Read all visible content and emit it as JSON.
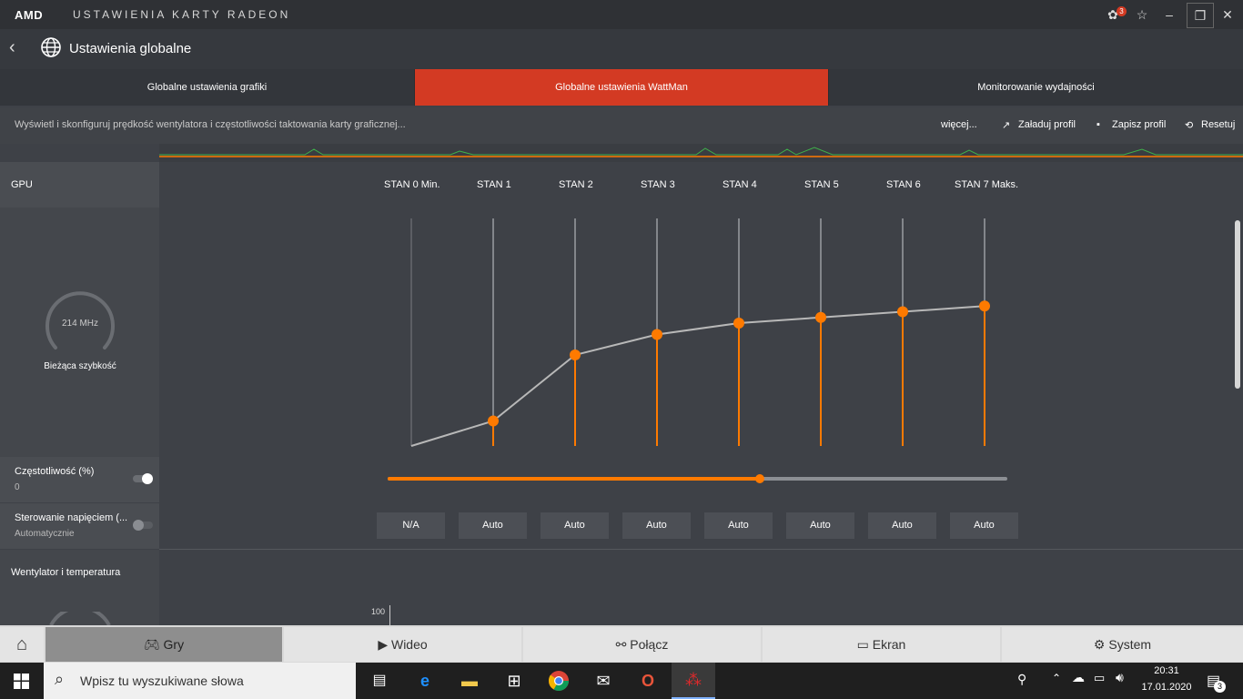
{
  "window": {
    "brand": "AMD",
    "title": "USTAWIENIA KARTY RADEON",
    "notif_badge": "3"
  },
  "header": {
    "title": "Ustawienia globalne"
  },
  "tabs": [
    {
      "label": "Globalne ustawienia grafiki",
      "active": false
    },
    {
      "label": "Globalne ustawienia WattMan",
      "active": true
    },
    {
      "label": "Monitorowanie wydajności",
      "active": false
    }
  ],
  "infobar": {
    "description": "Wyświetl i skonfiguruj prędkość wentylatora i częstotliwości taktowania karty graficznej...",
    "more": "więcej...",
    "load_profile": "Załaduj profil",
    "save_profile": "Zapisz profil",
    "reset": "Resetuj"
  },
  "gpu": {
    "section_label": "GPU",
    "gauge_value": "214 MHz",
    "gauge_label": "Bieżąca szybkość",
    "frequency": {
      "title": "Częstotliwość (%)",
      "value": "0",
      "toggle_on": true
    },
    "voltage": {
      "title": "Sterowanie napięciem (...",
      "value": "Automatycznie",
      "toggle_on": false
    },
    "states": [
      "STAN 0 Min.",
      "STAN 1",
      "STAN 2",
      "STAN 3",
      "STAN 4",
      "STAN 5",
      "STAN 6",
      "STAN 7 Maks."
    ],
    "state_values": [
      "N/A",
      "Auto",
      "Auto",
      "Auto",
      "Auto",
      "Auto",
      "Auto",
      "Auto"
    ],
    "slider_level_pct": 60
  },
  "chart_data": {
    "type": "line",
    "categories": [
      "STAN 0 Min.",
      "STAN 1",
      "STAN 2",
      "STAN 3",
      "STAN 4",
      "STAN 5",
      "STAN 6",
      "STAN 7 Maks."
    ],
    "series": [
      {
        "values": [
          0,
          11,
          40,
          49,
          54,
          56.5,
          59,
          61.5
        ]
      }
    ],
    "ylim": [
      0,
      100
    ],
    "colors": {
      "line": "#b8b8b8",
      "point": "#ff7a00"
    }
  },
  "fan": {
    "section_label": "Wentylator i temperatura",
    "y_tick": "100"
  },
  "bottom_nav": [
    {
      "label": "Gry",
      "icon": "gamepad-icon",
      "active": true
    },
    {
      "label": "Wideo",
      "icon": "play-icon",
      "active": false
    },
    {
      "label": "Połącz",
      "icon": "share-icon",
      "active": false
    },
    {
      "label": "Ekran",
      "icon": "monitor-icon",
      "active": false
    },
    {
      "label": "System",
      "icon": "system-icon",
      "active": false
    }
  ],
  "taskbar": {
    "search_placeholder": "Wpisz tu wyszukiwane słowa",
    "time": "20:31",
    "date": "17.01.2020",
    "notif_count": "3"
  },
  "colors": {
    "accent": "#d33a23",
    "orange": "#ff7a00"
  }
}
